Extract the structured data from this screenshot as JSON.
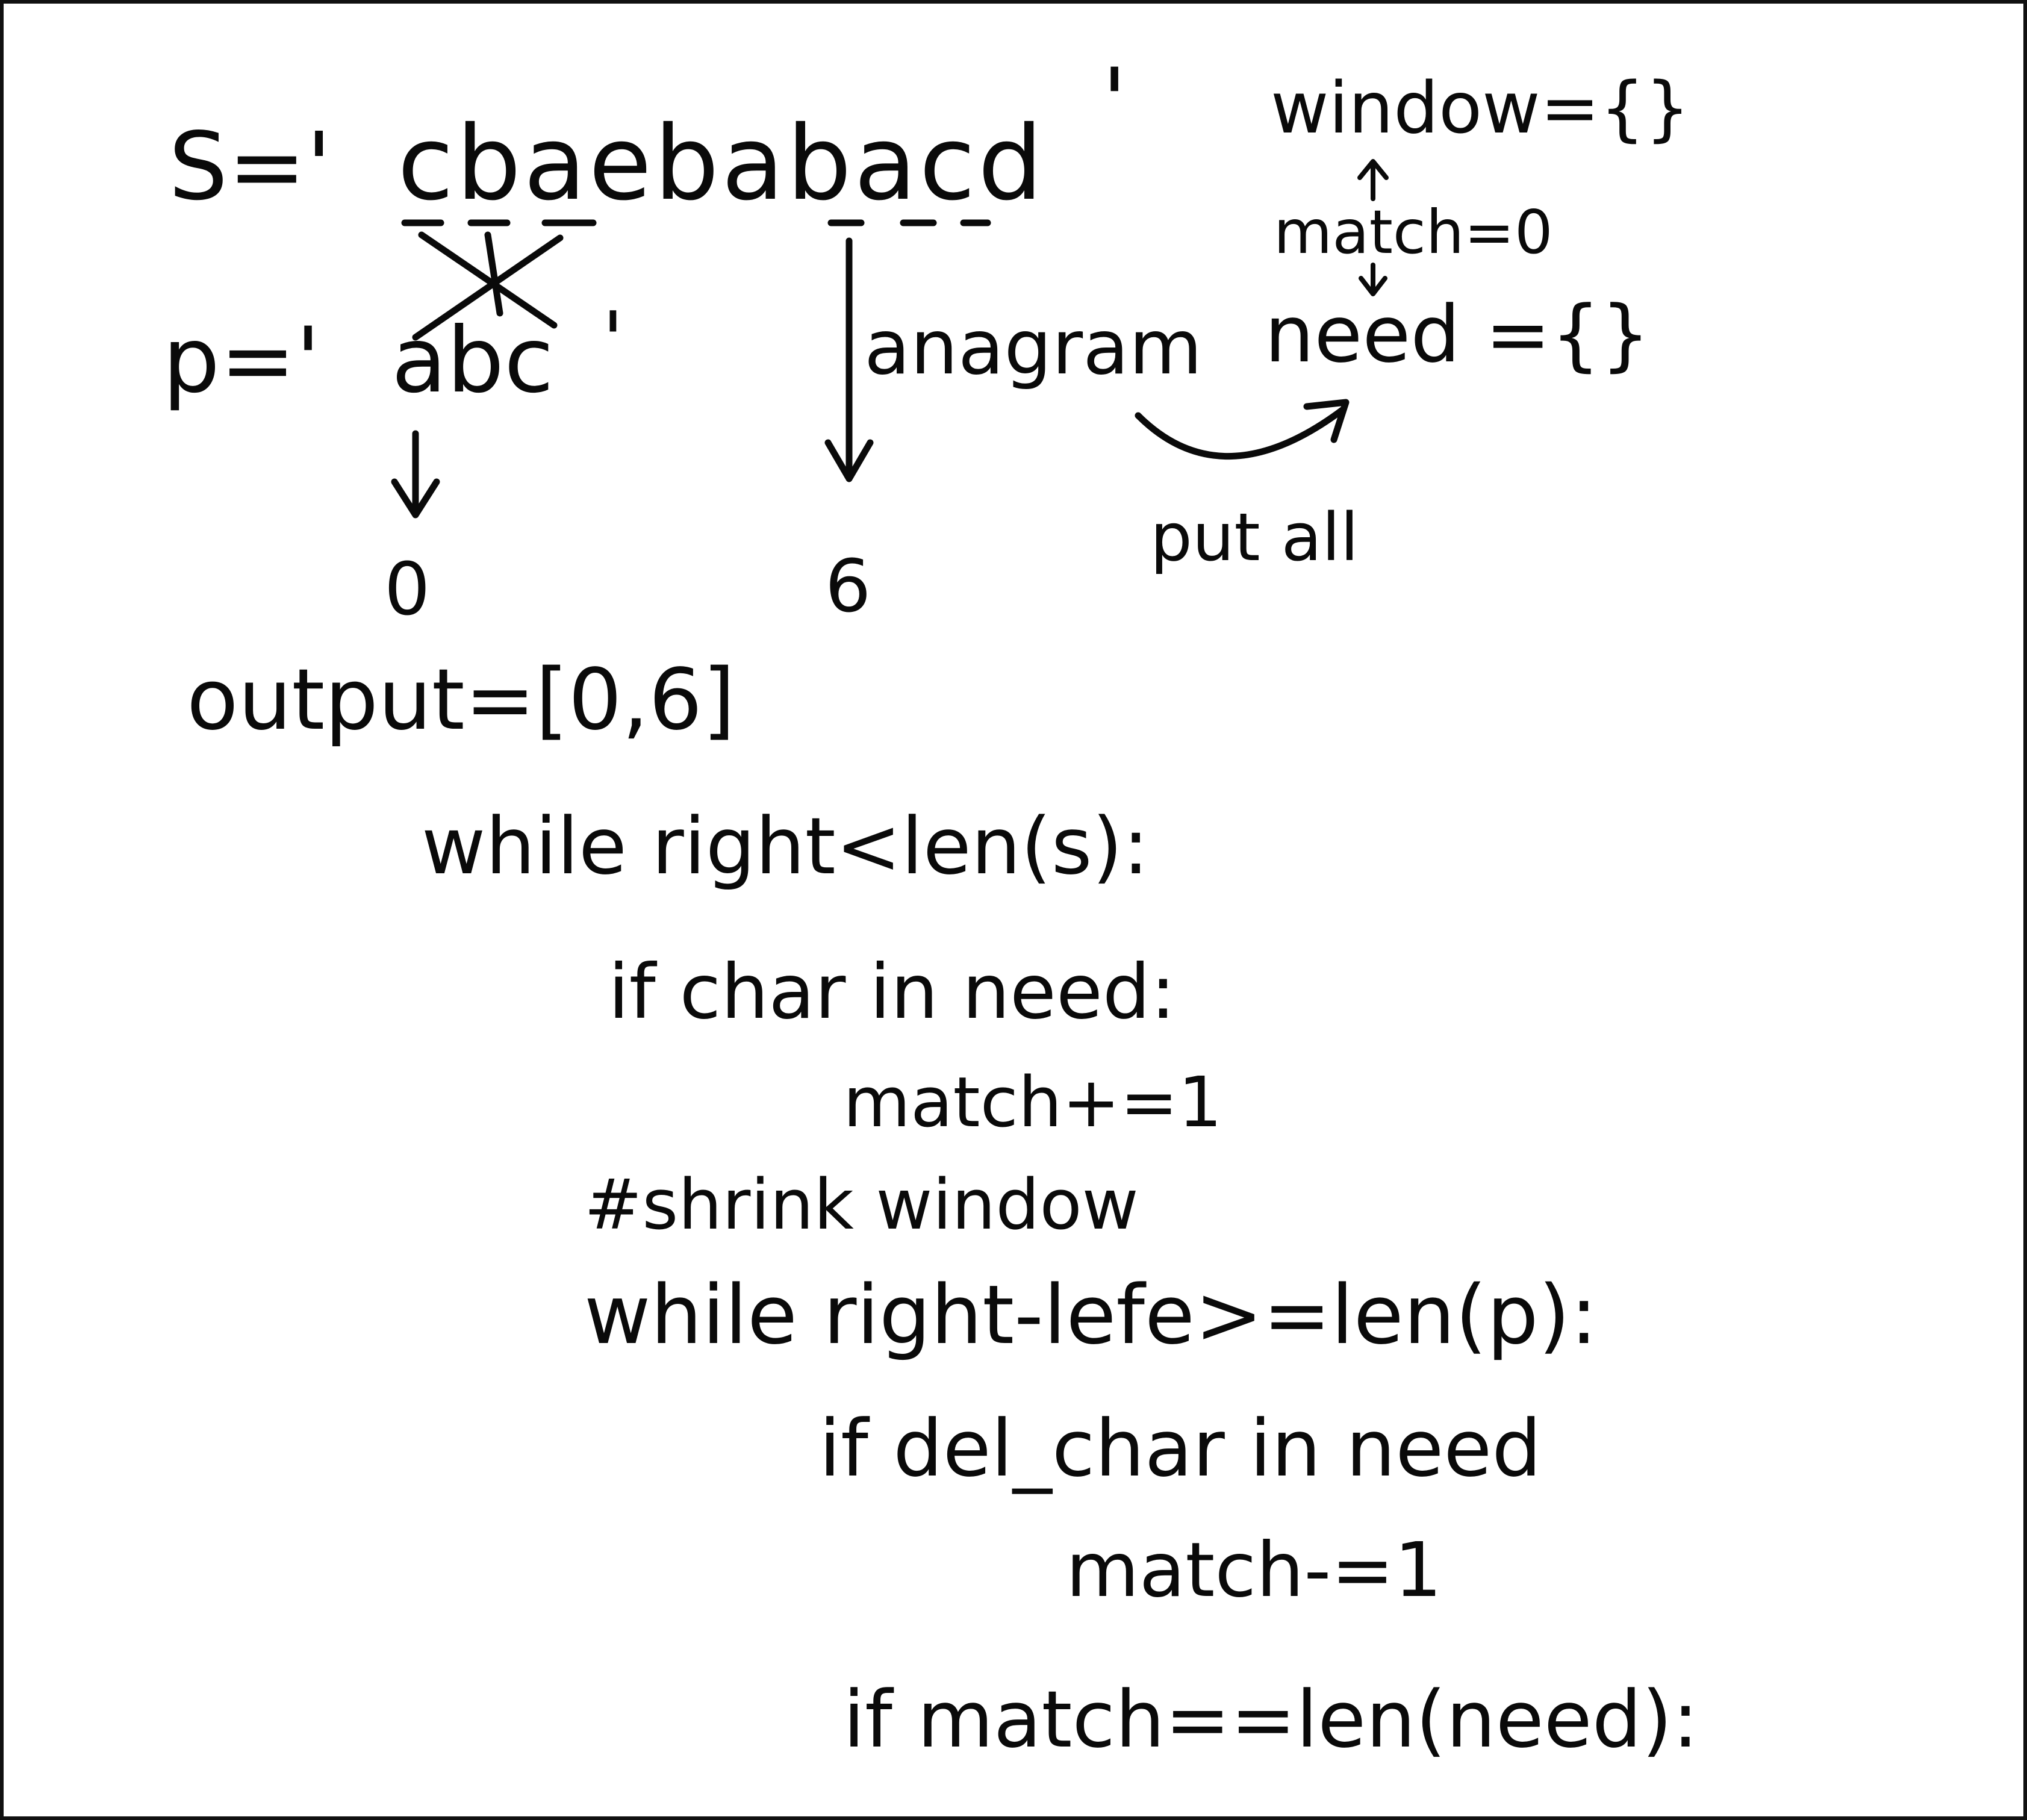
{
  "s_prefix": "S='",
  "s_string": "cbaebabacd",
  "s_suffix": "'",
  "p_prefix": "p='",
  "p_string": "abc",
  "p_suffix": "'",
  "label_anagram": "anagram",
  "label_window": "window={}",
  "label_match": "match=0",
  "label_need": "need ={}",
  "label_put_all": "put all",
  "index_first": "0",
  "index_second": "6",
  "output_line": "output=[0,6]",
  "code": {
    "line1": "while right<len(s):",
    "line2": "if char in need:",
    "line3": "match+=1",
    "line4": "#shrink window",
    "line5": "while right-lefe>=len(p):",
    "line6": "if del_char in need",
    "line7": "match-=1",
    "line8": "if match==len(need):"
  }
}
